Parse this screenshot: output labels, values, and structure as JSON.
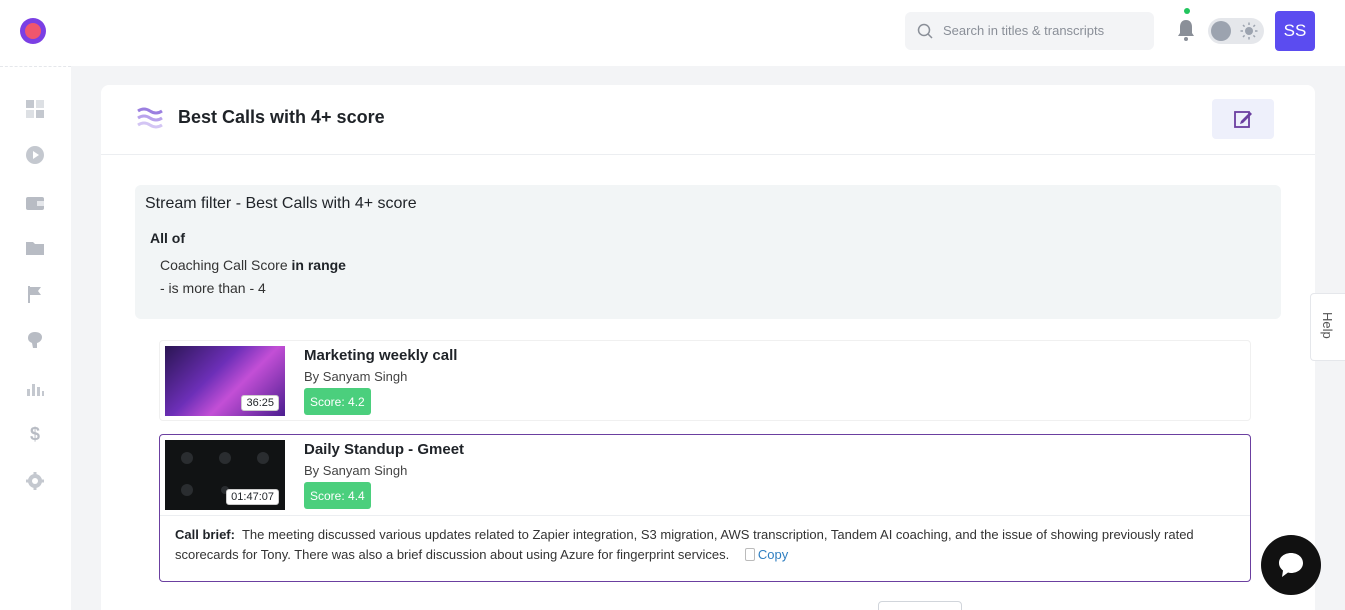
{
  "search": {
    "placeholder": "Search in titles & transcripts"
  },
  "user": {
    "initials": "SS"
  },
  "sidebar": {
    "items": [
      {
        "icon": "dashboard-icon"
      },
      {
        "icon": "play-icon"
      },
      {
        "icon": "wallet-icon"
      },
      {
        "icon": "folder-icon"
      },
      {
        "icon": "flag-icon"
      },
      {
        "icon": "brain-icon"
      },
      {
        "icon": "chart-icon"
      },
      {
        "icon": "dollar-icon",
        "glyph": "$"
      },
      {
        "icon": "settings-icon"
      }
    ]
  },
  "stream": {
    "title": "Best Calls with 4+ score",
    "filter_title": "Stream filter - Best Calls with 4+ score",
    "all_of": "All of",
    "condition_field": "Coaching Call Score",
    "condition_op": "in range",
    "condition_value": "- is more than - 4"
  },
  "calls": [
    {
      "title": "Marketing weekly call",
      "by": "By Sanyam Singh",
      "score": "Score: 4.2",
      "duration": "36:25"
    },
    {
      "title": "Daily Standup - Gmeet",
      "by": "By Sanyam Singh",
      "score": "Score: 4.4",
      "duration": "01:47:07",
      "brief_label": "Call brief:",
      "brief": "The meeting discussed various updates related to Zapier integration, S3 migration, AWS transcription, Tandem AI coaching, and the issue of showing previously rated scorecards for Tony. There was also a brief discussion about using Azure for fingerprint services.",
      "copy_label": "Copy"
    }
  ],
  "help": {
    "label": "Help"
  },
  "colors": {
    "accent": "#5b4cf0",
    "score_green": "#4bcf7d",
    "selected_border": "#6b3fa0"
  }
}
